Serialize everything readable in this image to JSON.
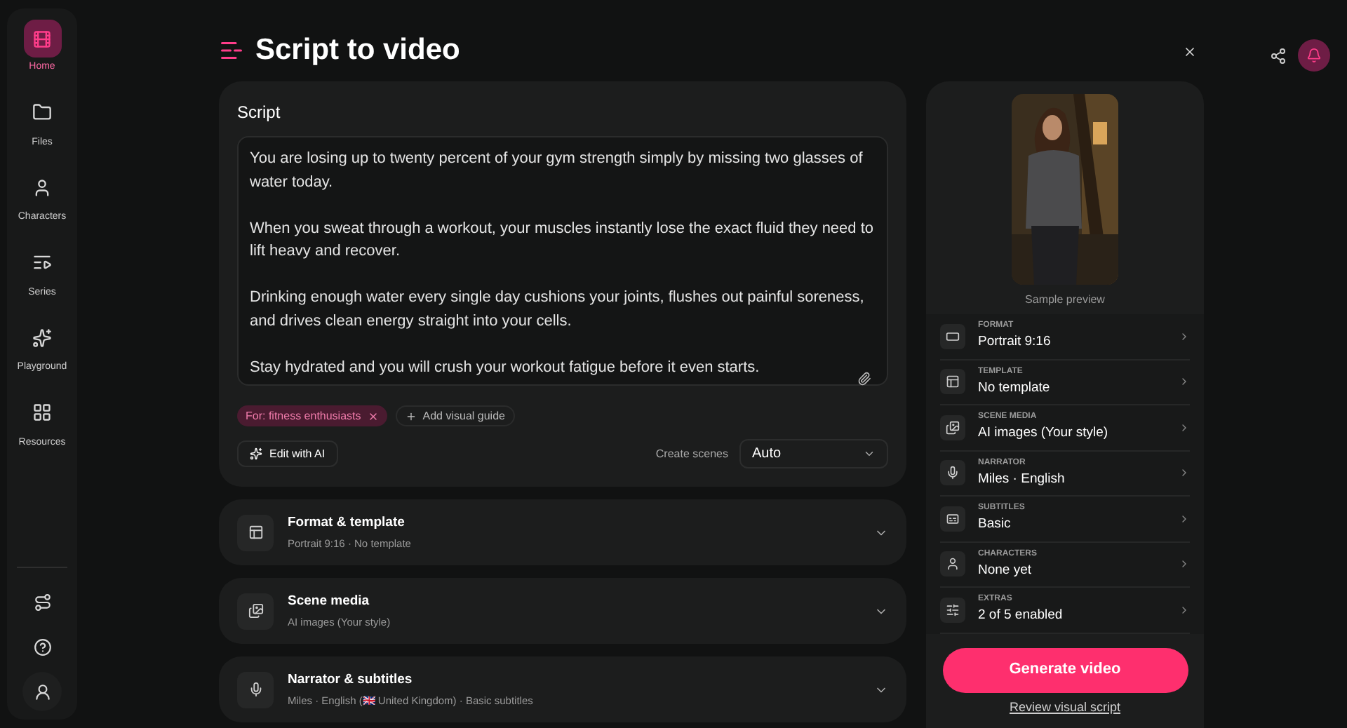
{
  "sidebar": {
    "items": [
      {
        "label": "Home",
        "selected": true
      },
      {
        "label": "Files",
        "selected": false
      },
      {
        "label": "Characters",
        "selected": false
      },
      {
        "label": "Series",
        "selected": false
      },
      {
        "label": "Playground",
        "selected": false
      },
      {
        "label": "Resources",
        "selected": false
      }
    ]
  },
  "title": "Script to video",
  "script": {
    "heading": "Script",
    "value": "You are losing up to twenty percent of your gym strength simply by missing two glasses of water today.\n\nWhen you sweat through a workout, your muscles instantly lose the exact fluid they need to lift heavy and recover.\n\nDrinking enough water every single day cushions your joints, flushes out painful soreness, and drives clean energy straight into your cells.\n\nStay hydrated and you will crush your workout fatigue before it even starts.",
    "tag": "For: fitness enthusiasts",
    "add_guide": "Add visual guide",
    "edit_button": "Edit with AI",
    "scenes_label": "Create scenes",
    "scenes_value": "Auto"
  },
  "sections": [
    {
      "title": "Format & template",
      "subtitle": "Portrait 9:16 · No template",
      "expanded": false
    },
    {
      "title": "Scene media",
      "subtitle": "AI images (Your style)",
      "expanded": false
    },
    {
      "title": "Narrator & subtitles",
      "subtitle": "Miles · English (🇬🇧 United Kingdom) · Basic subtitles",
      "expanded": false
    }
  ],
  "preview": {
    "caption": "Sample preview"
  },
  "settings": [
    {
      "label": "FORMAT",
      "value": "Portrait 9:16"
    },
    {
      "label": "TEMPLATE",
      "value": "No template"
    },
    {
      "label": "SCENE MEDIA",
      "value": "AI images (Your style)"
    },
    {
      "label": "NARRATOR",
      "value": "Miles · English"
    },
    {
      "label": "SUBTITLES",
      "value": "Basic"
    },
    {
      "label": "CHARACTERS",
      "value": "None yet"
    },
    {
      "label": "EXTRAS",
      "value": "2 of 5 enabled"
    }
  ],
  "generate_button": "Generate video",
  "review_link": "Review visual script"
}
